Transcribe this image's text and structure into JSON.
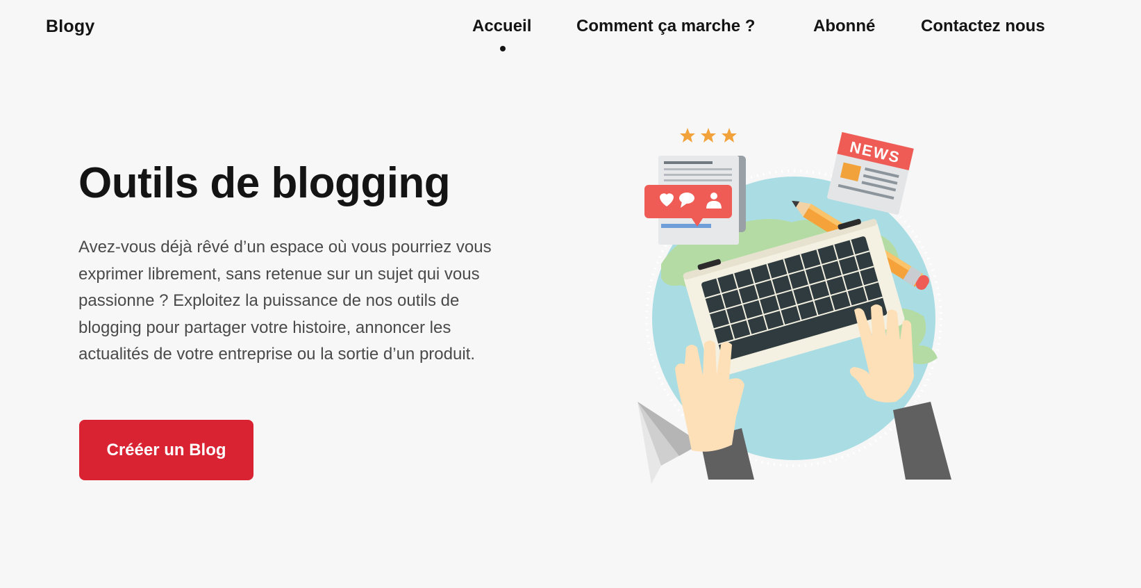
{
  "header": {
    "logo": "Blogy",
    "nav": [
      {
        "label": "Accueil",
        "active": true
      },
      {
        "label": "Comment ça marche ?",
        "active": false
      },
      {
        "label": "Abonné",
        "active": false
      },
      {
        "label": "Contactez nous",
        "active": false
      }
    ]
  },
  "hero": {
    "title": "Outils de blogging",
    "description": "Avez-vous déjà rêvé d’un espace où vous pourriez vous exprimer librement, sans retenue sur un sujet qui vous passionne ? Exploitez la puissance de nos outils de blogging pour partager votre histoire, annoncer les actualités de votre entreprise ou la sortie d’un produit.",
    "cta_label": "Crééer un Blog"
  },
  "illustration": {
    "news_label": "NEWS",
    "star_count": 3,
    "icons": [
      "heart-icon",
      "comment-icon",
      "user-icon",
      "pencil-icon",
      "paper-plane-icon",
      "laptop-icon",
      "globe-icon"
    ]
  },
  "colors": {
    "accent": "#d92332",
    "background": "#f7f7f7",
    "text": "#141414",
    "body_text": "#4a4a4a",
    "globe": "#aadde3",
    "land": "#b5dba4",
    "star": "#f2a23a",
    "social_badge": "#ef5b55"
  }
}
